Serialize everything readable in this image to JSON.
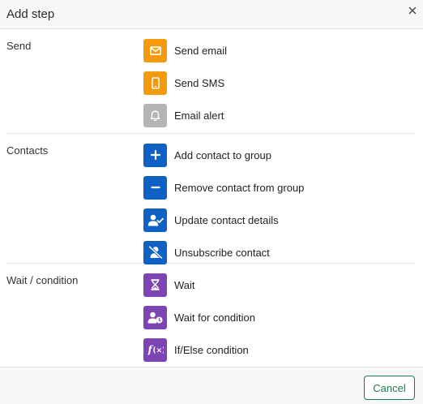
{
  "dialog": {
    "title": "Add step",
    "close_label": "×",
    "cancel_label": "Cancel"
  },
  "colors": {
    "orange": "#f59a0c",
    "gray": "#b5b5b5",
    "blue": "#0e62c6",
    "purple": "#7d45b4",
    "cancel_border": "#1f7a4d"
  },
  "sections": [
    {
      "label": "Send",
      "items": [
        {
          "label": "Send email",
          "icon": "envelope-icon",
          "color": "#f59a0c"
        },
        {
          "label": "Send SMS",
          "icon": "phone-icon",
          "color": "#f59a0c"
        },
        {
          "label": "Email alert",
          "icon": "bell-icon",
          "color": "#b5b5b5"
        }
      ]
    },
    {
      "label": "Contacts",
      "items": [
        {
          "label": "Add contact to group",
          "icon": "plus-icon",
          "color": "#0e62c6"
        },
        {
          "label": "Remove contact from group",
          "icon": "minus-icon",
          "color": "#0e62c6"
        },
        {
          "label": "Update contact details",
          "icon": "user-check-icon",
          "color": "#0e62c6"
        },
        {
          "label": "Unsubscribe contact",
          "icon": "user-off-icon",
          "color": "#0e62c6"
        }
      ]
    },
    {
      "label": "Wait / condition",
      "items": [
        {
          "label": "Wait",
          "icon": "hourglass-icon",
          "color": "#7d45b4"
        },
        {
          "label": "Wait for condition",
          "icon": "user-clock-icon",
          "color": "#7d45b4"
        },
        {
          "label": "If/Else condition",
          "icon": "function-icon",
          "color": "#7d45b4"
        }
      ]
    }
  ]
}
